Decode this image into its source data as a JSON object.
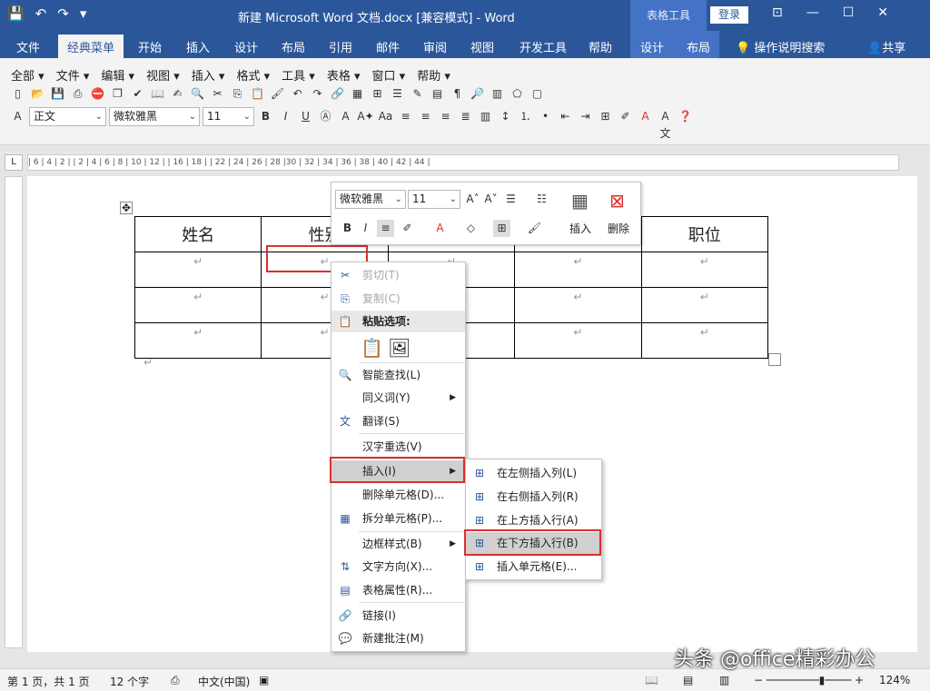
{
  "titlebar": {
    "title": "新建 Microsoft Word 文档.docx [兼容模式] - Word",
    "context_tab": "表格工具",
    "login": "登录",
    "qat": [
      "save",
      "undo",
      "redo",
      "customize"
    ]
  },
  "tabs": {
    "items": [
      "文件",
      "经典菜单",
      "开始",
      "插入",
      "设计",
      "布局",
      "引用",
      "邮件",
      "审阅",
      "视图",
      "开发工具",
      "帮助",
      "设计",
      "布局"
    ],
    "active": "经典菜单",
    "tell_me": "操作说明搜索",
    "share": "共享"
  },
  "classic_menu": [
    "全部",
    "文件",
    "编辑",
    "视图",
    "插入",
    "格式",
    "工具",
    "表格",
    "窗口",
    "帮助"
  ],
  "format_bar": {
    "style": "正文",
    "font": "微软雅黑",
    "size": "11",
    "bold": "B",
    "italic": "I",
    "underline": "U"
  },
  "ruler": {
    "corner": "L",
    "ticks": "| 6 | 4 | 2 |  | 2 | 4 | 6 | 8 | 10 | 12 |  | 16 | 18 |  | 22 | 24 | 26 | 28 |30 | 32 | 34 | 36 | 38 | 40 | 42 | 44 |"
  },
  "table": {
    "header": [
      "姓名",
      "性别",
      "",
      "",
      "职位"
    ],
    "para_mark": "↵"
  },
  "mini_toolbar": {
    "font": "微软雅黑",
    "size": "11",
    "bold": "B",
    "italic": "I",
    "insert": "插入",
    "delete": "删除"
  },
  "context_menu": {
    "cut": "剪切(T)",
    "copy": "复制(C)",
    "paste_options": "粘贴选项:",
    "smart_lookup": "智能查找(L)",
    "synonyms": "同义词(Y)",
    "translate": "翻译(S)",
    "reconvert": "汉字重选(V)",
    "insert": "插入(I)",
    "delete_cells": "删除单元格(D)...",
    "split_cells": "拆分单元格(P)...",
    "border_styles": "边框样式(B)",
    "text_direction": "文字方向(X)...",
    "table_properties": "表格属性(R)...",
    "link": "链接(I)",
    "new_comment": "新建批注(M)"
  },
  "insert_submenu": {
    "left_col": "在左侧插入列(L)",
    "right_col": "在右侧插入列(R)",
    "above_row": "在上方插入行(A)",
    "below_row": "在下方插入行(B)",
    "cells": "插入单元格(E)..."
  },
  "status": {
    "page": "第 1 页，共 1 页",
    "words": "12 个字",
    "lang": "中文(中国)",
    "zoom": "124%"
  },
  "watermark": "头条 @office精彩办公",
  "colors": {
    "brand": "#2b579a",
    "context": "#4472c4",
    "highlight": "#d9302f"
  }
}
